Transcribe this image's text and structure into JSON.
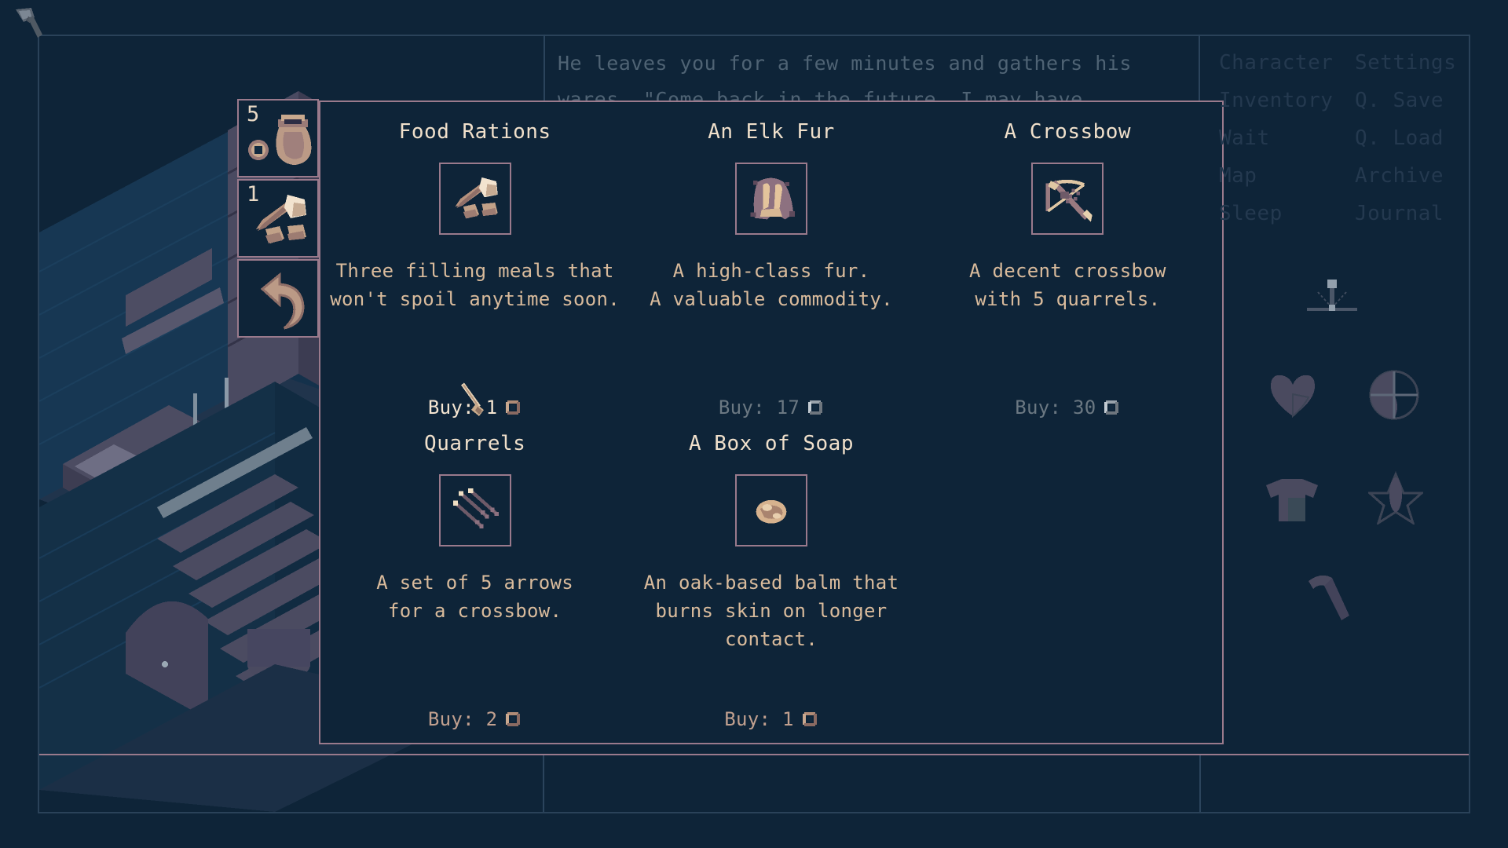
{
  "theme": {
    "bg": "#0e2438",
    "panel_border": "#9a7a8c",
    "frame_border": "#2a4259",
    "title_text": "#f0e0cb",
    "desc_text": "#d9bb9c",
    "dim_text": "#24394f",
    "dialogue_text": "#4f6374"
  },
  "dialogue": {
    "text": "He leaves you for a few minutes and gathers his wares. \"Come back in the future, I may have something new that I'll be"
  },
  "inventory": {
    "slots": [
      {
        "count": "5",
        "icon": "coin-pouch-icon",
        "name": "money-pouch"
      },
      {
        "count": "1",
        "icon": "food-rations-icon",
        "name": "food-rations"
      },
      {
        "count": "",
        "icon": "back-arrow-icon",
        "name": "back"
      }
    ]
  },
  "shop": {
    "items": [
      {
        "title": "Food Rations",
        "icon": "food-rations-icon",
        "desc": "Three filling meals that\nwon't spoil anytime soon.",
        "buy_label": "Buy: 1",
        "price": 1,
        "coin": "copper",
        "affordability": "affordable"
      },
      {
        "title": "An Elk Fur",
        "icon": "elk-fur-icon",
        "desc": "A high-class fur.\nA valuable commodity.",
        "buy_label": "Buy: 17",
        "price": 17,
        "coin": "silver",
        "affordability": "expensive"
      },
      {
        "title": "A Crossbow",
        "icon": "crossbow-icon",
        "desc": "A decent crossbow\nwith 5 quarrels.",
        "buy_label": "Buy: 30",
        "price": 30,
        "coin": "silver",
        "affordability": "expensive"
      },
      {
        "title": "Quarrels",
        "icon": "quarrels-icon",
        "desc": "A set of 5 arrows\nfor a crossbow.",
        "buy_label": "Buy: 2",
        "price": 2,
        "coin": "copper",
        "affordability": "cheap"
      },
      {
        "title": "A Box of Soap",
        "icon": "soap-icon",
        "desc": "An oak-based balm that\nburns skin on longer\ncontact.",
        "buy_label": "Buy: 1",
        "price": 1,
        "coin": "copper",
        "affordability": "cheap"
      }
    ]
  },
  "menu": {
    "items": [
      "Character",
      "Settings",
      "Inventory",
      "Q. Save",
      "Wait",
      "Q. Load",
      "Map",
      "Archive",
      "Sleep",
      "Journal"
    ]
  },
  "hud": {
    "icons": [
      "compass-pin-icon",
      "heart-health-icon",
      "head-armor-icon",
      "shirt-armor-icon",
      "star-skill-icon",
      "axe-weapon-icon"
    ]
  },
  "cursor": {
    "icon": "brush-cursor-icon"
  }
}
